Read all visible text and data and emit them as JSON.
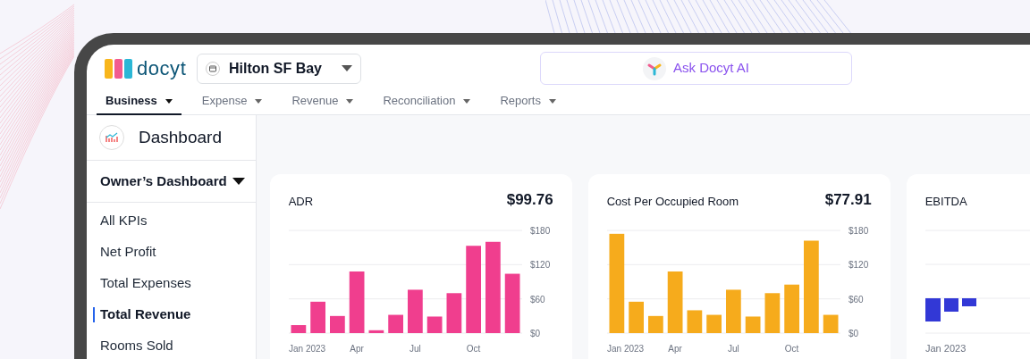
{
  "header": {
    "logo": "docyt",
    "property_selector": {
      "value": "Hilton SF Bay"
    },
    "ai_button": {
      "label": "Ask Docyt AI"
    }
  },
  "nav_tabs": [
    {
      "label": "Business",
      "selected": true
    },
    {
      "label": "Expense",
      "selected": false
    },
    {
      "label": "Revenue",
      "selected": false
    },
    {
      "label": "Reconciliation",
      "selected": false
    },
    {
      "label": "Reports",
      "selected": false
    }
  ],
  "sidebar": {
    "title": "Dashboard",
    "section": {
      "label": "Owner’s Dashboard",
      "expanded": true
    },
    "items": [
      {
        "label": "All KPIs",
        "selected": false
      },
      {
        "label": "Net Profit",
        "selected": false
      },
      {
        "label": "Total Expenses",
        "selected": false
      },
      {
        "label": "Total Revenue",
        "selected": true
      },
      {
        "label": "Rooms Sold",
        "selected": false
      }
    ]
  },
  "cards": [
    {
      "title": "ADR",
      "value": "$99.76",
      "chart_data": {
        "type": "bar",
        "categories": [
          "Jan 2023",
          null,
          null,
          "Apr",
          null,
          null,
          "Jul",
          null,
          null,
          "Oct",
          null,
          null
        ],
        "ylim": [
          0,
          180
        ],
        "yticks": [
          {
            "value": 0,
            "label": "$0"
          },
          {
            "value": 60,
            "label": "$60"
          },
          {
            "value": 120,
            "label": "$120"
          },
          {
            "value": 180,
            "label": "$180"
          }
        ],
        "series": [
          {
            "color": "#f03e8e",
            "values": [
              14,
              55,
              30,
              108,
              5,
              32,
              76,
              29,
              70,
              153,
              160,
              104
            ]
          }
        ]
      }
    },
    {
      "title": "Cost Per Occupied Room",
      "value": "$77.91",
      "chart_data": {
        "type": "bar",
        "categories": [
          "Jan 2023",
          null,
          null,
          "Apr",
          null,
          null,
          "Jul",
          null,
          null,
          "Oct",
          null,
          null
        ],
        "ylim": [
          0,
          180
        ],
        "yticks": [
          {
            "value": 0,
            "label": "$0"
          },
          {
            "value": 60,
            "label": "$60"
          },
          {
            "value": 120,
            "label": "$120"
          },
          {
            "value": 180,
            "label": "$180"
          }
        ],
        "series": [
          {
            "color": "#f6ab1c",
            "values": [
              174,
              55,
              30,
              108,
              40,
              32,
              76,
              29,
              70,
              85,
              162,
              32
            ]
          }
        ]
      }
    },
    {
      "title": "EBITDA",
      "x_label": "Jan 2023"
    }
  ]
}
